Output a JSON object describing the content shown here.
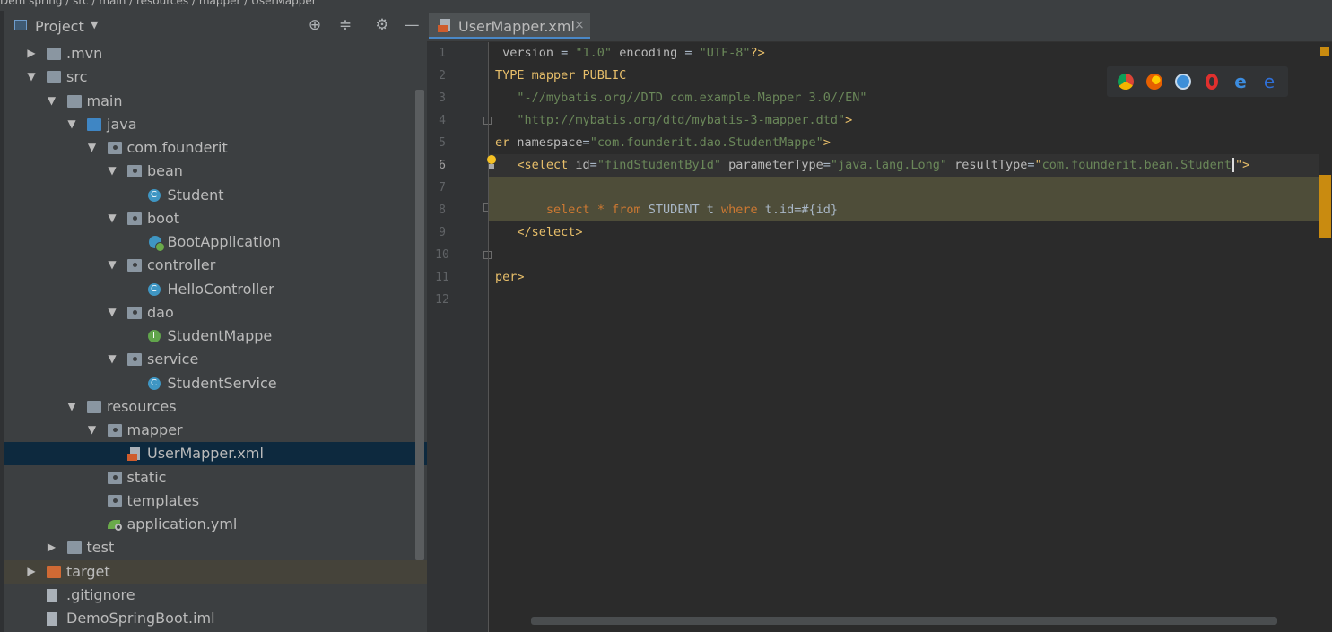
{
  "topbar": {
    "partial_text": "Dem   spring   /   src   /   main   /   resources   /   mapper   /   UserMapper"
  },
  "project_panel": {
    "title": "Project",
    "tools": [
      "target-icon",
      "collapse-icon",
      "gear-icon",
      "minimize-icon"
    ],
    "tree": [
      {
        "label": ".mvn",
        "expanded": false,
        "icon": "folder"
      },
      {
        "label": "src",
        "expanded": true,
        "icon": "folder"
      },
      {
        "label": "main",
        "expanded": true,
        "icon": "folder"
      },
      {
        "label": "java",
        "expanded": true,
        "icon": "folder-blue"
      },
      {
        "label": "com.founderit",
        "expanded": true,
        "icon": "package"
      },
      {
        "label": "bean",
        "expanded": true,
        "icon": "package"
      },
      {
        "label": "Student",
        "icon": "class"
      },
      {
        "label": "boot",
        "expanded": true,
        "icon": "package"
      },
      {
        "label": "BootApplication",
        "icon": "spring-boot-class"
      },
      {
        "label": "controller",
        "expanded": true,
        "icon": "package"
      },
      {
        "label": "HelloController",
        "icon": "class"
      },
      {
        "label": "dao",
        "expanded": true,
        "icon": "package"
      },
      {
        "label": "StudentMappe",
        "icon": "interface"
      },
      {
        "label": "service",
        "expanded": true,
        "icon": "package"
      },
      {
        "label": "StudentService",
        "icon": "class"
      },
      {
        "label": "resources",
        "expanded": true,
        "icon": "resources-folder"
      },
      {
        "label": "mapper",
        "expanded": true,
        "icon": "package"
      },
      {
        "label": "UserMapper.xml",
        "icon": "xml-file",
        "selected": true
      },
      {
        "label": "static",
        "icon": "package"
      },
      {
        "label": "templates",
        "icon": "package"
      },
      {
        "label": "application.yml",
        "icon": "yml-file"
      },
      {
        "label": "test",
        "expanded": false,
        "icon": "folder"
      },
      {
        "label": "target",
        "expanded": false,
        "icon": "folder-orange",
        "highlighted": true
      },
      {
        "label": ".gitignore",
        "icon": "file"
      },
      {
        "label": "DemoSpringBoot.iml",
        "icon": "file"
      }
    ]
  },
  "editor": {
    "tab": {
      "label": "UserMapper.xml",
      "close": "×"
    },
    "line_numbers": [
      "1",
      "2",
      "3",
      "4",
      "5",
      "6",
      "7",
      "8",
      "9",
      "10",
      "11",
      "12"
    ],
    "current_line": "6",
    "browser_icons": [
      "chrome-icon",
      "firefox-icon",
      "safari-icon",
      "opera-icon",
      "ie-icon",
      "edge-icon"
    ],
    "lines": {
      "l1": [
        {
          "c": "a",
          "t": " version"
        },
        {
          "c": "p",
          "t": " = "
        },
        {
          "c": "s",
          "t": "\"1.0\""
        },
        {
          "c": "a",
          "t": " encoding"
        },
        {
          "c": "p",
          "t": " = "
        },
        {
          "c": "s",
          "t": "\"UTF-8\""
        },
        {
          "c": "t",
          "t": "?>"
        }
      ],
      "l2": [
        {
          "c": "t",
          "t": "TYPE mapper PUBLIC"
        }
      ],
      "l3": [
        {
          "c": "s",
          "t": "   \"-//mybatis.org//DTD com.example.Mapper 3.0//EN\""
        }
      ],
      "l4": [
        {
          "c": "s",
          "t": "   \"http://mybatis.org/dtd/mybatis-3-mapper.dtd\""
        },
        {
          "c": "t",
          "t": ">"
        }
      ],
      "l5": [
        {
          "c": "t",
          "t": "er "
        },
        {
          "c": "a",
          "t": "namespace"
        },
        {
          "c": "p",
          "t": "="
        },
        {
          "c": "s",
          "t": "\"com.founderit.dao.StudentMappe\""
        },
        {
          "c": "t",
          "t": ">"
        }
      ],
      "l6": [
        {
          "c": "t",
          "t": "   <select "
        },
        {
          "c": "a",
          "t": "id"
        },
        {
          "c": "p",
          "t": "="
        },
        {
          "c": "s",
          "t": "\"findStudentById\""
        },
        {
          "c": "a",
          "t": " parameterType"
        },
        {
          "c": "p",
          "t": "="
        },
        {
          "c": "s",
          "t": "\"java.lang.Long\""
        },
        {
          "c": "a",
          "t": " resultType"
        },
        {
          "c": "p",
          "t": "="
        },
        {
          "c": "t",
          "t": "\""
        },
        {
          "c": "s",
          "t": "com.founderit.bean.Student"
        },
        {
          "c": "caret",
          "t": ""
        },
        {
          "c": "t",
          "t": "\">"
        }
      ],
      "l8": [
        {
          "c": "k",
          "t": "       select"
        },
        {
          "c": "p",
          "t": " "
        },
        {
          "c": "k",
          "t": "*"
        },
        {
          "c": "p",
          "t": " "
        },
        {
          "c": "k",
          "t": "from"
        },
        {
          "c": "p",
          "t": " STUDENT t "
        },
        {
          "c": "k",
          "t": "where"
        },
        {
          "c": "p",
          "t": " t.id=#{id}"
        }
      ],
      "l9": [
        {
          "c": "t",
          "t": "   </select>"
        }
      ],
      "l11": [
        {
          "c": "t",
          "t": "per>"
        }
      ]
    }
  },
  "colors": {
    "selection": "#0d293e",
    "highlight": "#4e4d39",
    "tag": "#e8bf6a",
    "string": "#6a8759",
    "keyword": "#cc7832"
  }
}
